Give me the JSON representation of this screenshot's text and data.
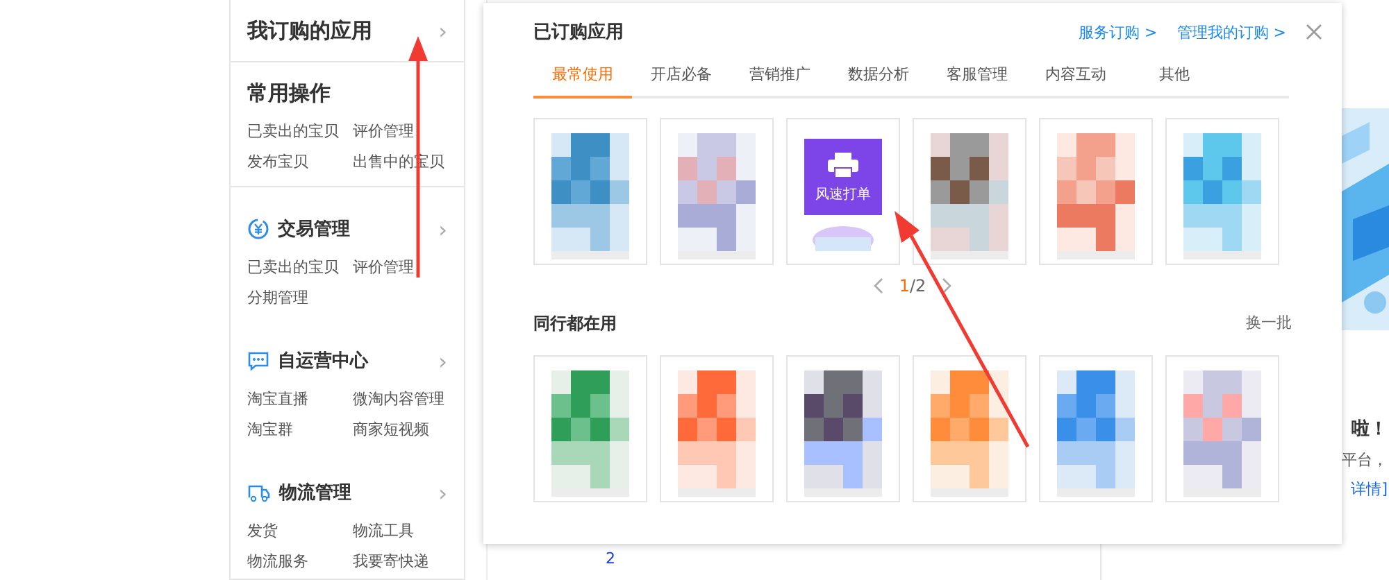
{
  "sidebar": {
    "header": {
      "title": "我订购的应用",
      "chevron": "›"
    },
    "sections": [
      {
        "title": "常用操作",
        "kind": "plain",
        "items": [
          "已卖出的宝贝",
          "评价管理",
          "发布宝贝",
          "出售中的宝贝"
        ]
      },
      {
        "title": "交易管理",
        "kind": "trade",
        "chevron": "›",
        "items": [
          "已卖出的宝贝",
          "评价管理",
          "分期管理"
        ]
      },
      {
        "title": "自运营中心",
        "kind": "chat",
        "chevron": "›",
        "items": [
          "淘宝直播",
          "微淘内容管理",
          "淘宝群",
          "商家短视频"
        ]
      },
      {
        "title": "物流管理",
        "kind": "truck",
        "chevron": "›",
        "items": [
          "发货",
          "物流工具",
          "物流服务",
          "我要寄快递"
        ]
      }
    ]
  },
  "popup": {
    "title": "已订购应用",
    "links": [
      "服务订购 >",
      "管理我的订购 >"
    ],
    "tabs": [
      {
        "label": "最常使用",
        "selected": true
      },
      {
        "label": "开店必备",
        "selected": false
      },
      {
        "label": "营销推广",
        "selected": false
      },
      {
        "label": "数据分析",
        "selected": false
      },
      {
        "label": "客服管理",
        "selected": false
      },
      {
        "label": "内容互动",
        "selected": false
      },
      {
        "label": "其他",
        "selected": false
      }
    ],
    "apps": [
      {
        "kind": "picture"
      },
      {
        "kind": "picture"
      },
      {
        "kind": "app",
        "label": "风速打单"
      },
      {
        "kind": "picture"
      },
      {
        "kind": "picture"
      },
      {
        "kind": "picture"
      }
    ],
    "pager": {
      "current": "1",
      "total": "/2"
    },
    "peers": {
      "title": "同行都在用",
      "refresh": "换一批",
      "apps": [
        {
          "kind": "picture"
        },
        {
          "kind": "picture"
        },
        {
          "kind": "picture"
        },
        {
          "kind": "picture"
        },
        {
          "kind": "picture"
        },
        {
          "kind": "picture"
        }
      ]
    }
  },
  "background": {
    "notice": [
      "啦！",
      "平台，",
      "详情]"
    ],
    "stat_value": "2"
  },
  "annotation_arrows": [
    {
      "kind": "arrow"
    },
    {
      "kind": "arrow"
    }
  ]
}
